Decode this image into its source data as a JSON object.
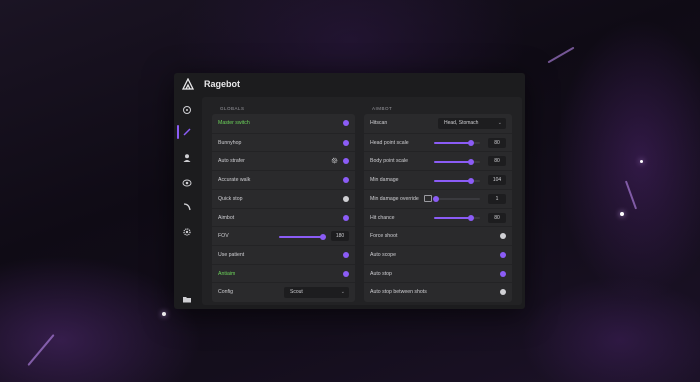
{
  "window": {
    "title": "Ragebot"
  },
  "sidebar": {
    "items": [
      {
        "icon": "crosshair-icon"
      },
      {
        "icon": "pencil-icon",
        "active": true
      },
      {
        "icon": "user-icon"
      },
      {
        "icon": "eye-icon"
      },
      {
        "icon": "arc-icon"
      },
      {
        "icon": "gear-icon"
      },
      {
        "icon": "folder-icon"
      }
    ]
  },
  "globals": {
    "section_label": "GLOBALS",
    "master_switch": {
      "label": "Master switch",
      "on": true
    },
    "bunnyhop": {
      "label": "Bunnyhop",
      "on": true
    },
    "auto_strafer": {
      "label": "Auto strafer",
      "on": true
    },
    "accurate_walk": {
      "label": "Accurate walk",
      "on": true
    },
    "quick_stop": {
      "label": "Quick stop",
      "on": false
    },
    "aimbot": {
      "label": "Aimbot",
      "on": true
    },
    "fov": {
      "label": "FOV",
      "value": "180",
      "fraction": 1.0
    },
    "use_patient": {
      "label": "Use patient",
      "on": true
    },
    "antiaim": {
      "label": "Antiaim",
      "on": true
    },
    "config": {
      "label": "Config",
      "selected": "Scout"
    }
  },
  "aimbot": {
    "section_label": "AIMBOT",
    "hitscan": {
      "label": "Hitscan",
      "selected": "Head, Stomach"
    },
    "head_point_scale": {
      "label": "Head point scale",
      "value": "80",
      "fraction": 0.8
    },
    "body_point_scale": {
      "label": "Body point scale",
      "value": "80",
      "fraction": 0.8
    },
    "min_damage": {
      "label": "Min damage",
      "value": "104",
      "fraction": 0.8
    },
    "min_damage_override": {
      "label": "Min damage override",
      "value": "1",
      "fraction": 0.0
    },
    "hit_chance": {
      "label": "Hit chance",
      "value": "80",
      "fraction": 0.8
    },
    "force_shoot": {
      "label": "Force shoot",
      "on": false
    },
    "auto_scope": {
      "label": "Auto scope",
      "on": true
    },
    "auto_stop": {
      "label": "Auto stop",
      "on": true
    },
    "auto_stop_between_shots": {
      "label": "Auto stop between shots",
      "on": false
    }
  },
  "colors": {
    "accent": "#8b5cf6",
    "highlight_label": "#6cd35a"
  }
}
